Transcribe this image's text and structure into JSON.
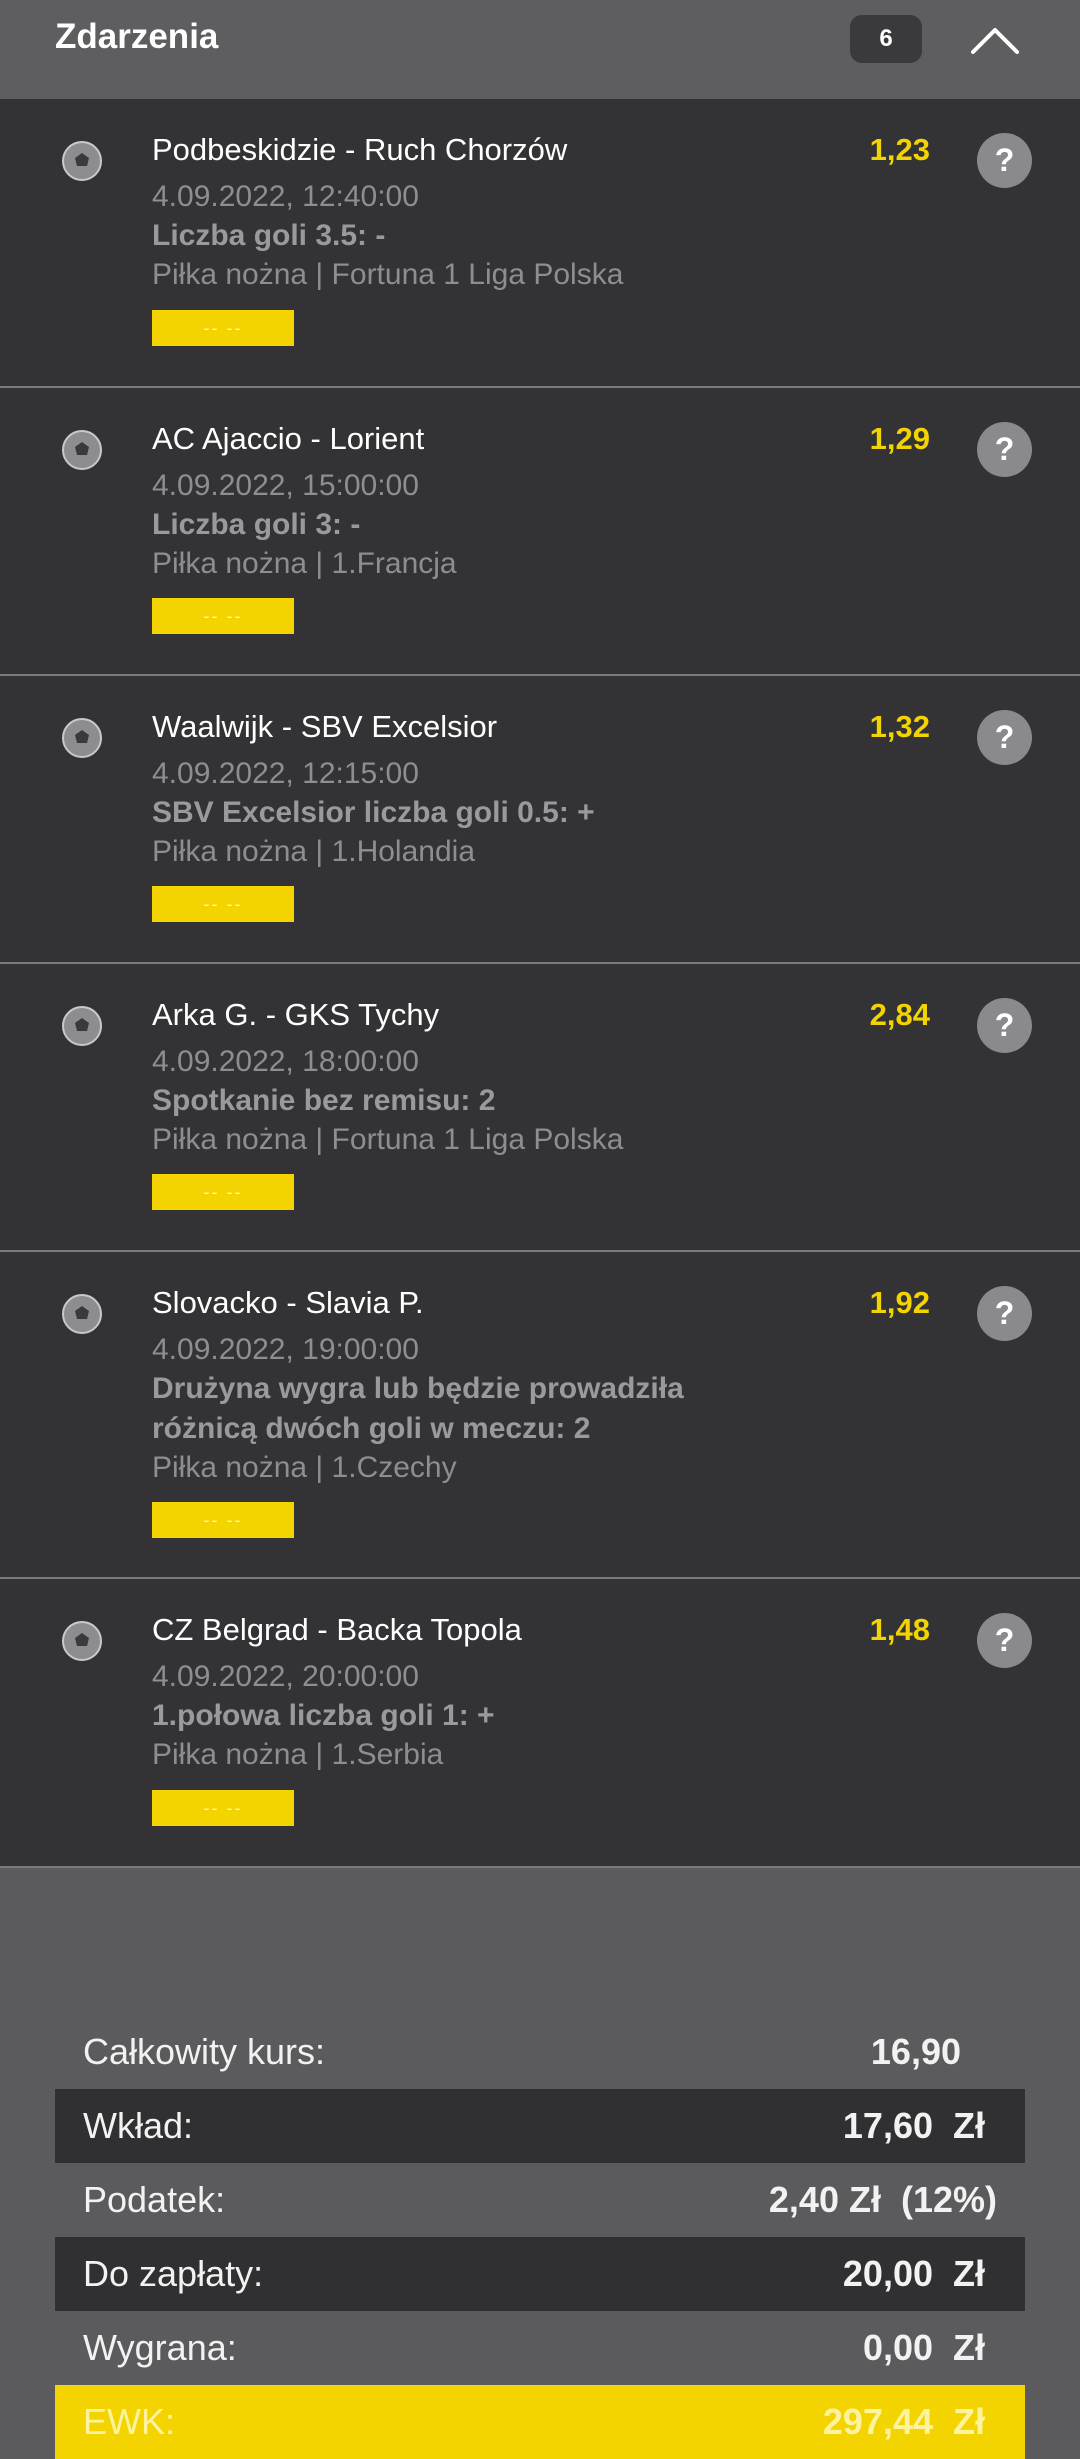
{
  "header": {
    "title": "Zdarzenia",
    "count": "6",
    "collapse_icon": "chevron-up-icon"
  },
  "events": [
    {
      "teams": "Podbeskidzie - Ruch Chorzów",
      "date": "4.09.2022, 12:40:00",
      "bet": "Liczba goli 3.5: -",
      "league": "Piłka nożna | Fortuna 1 Liga Polska",
      "odds": "1,23",
      "status": "-- --"
    },
    {
      "teams": "AC Ajaccio - Lorient",
      "date": "4.09.2022, 15:00:00",
      "bet": "Liczba goli 3: -",
      "league": "Piłka nożna | 1.Francja",
      "odds": "1,29",
      "status": "-- --"
    },
    {
      "teams": "Waalwijk - SBV Excelsior",
      "date": "4.09.2022, 12:15:00",
      "bet": "SBV Excelsior liczba goli 0.5: +",
      "league": "Piłka nożna | 1.Holandia",
      "odds": "1,32",
      "status": "-- --"
    },
    {
      "teams": "Arka G. - GKS Tychy",
      "date": "4.09.2022, 18:00:00",
      "bet": "Spotkanie bez remisu: 2",
      "league": "Piłka nożna | Fortuna 1 Liga Polska",
      "odds": "2,84",
      "status": "-- --"
    },
    {
      "teams": "Slovacko - Slavia P.",
      "date": "4.09.2022, 19:00:00",
      "bet": "Drużyna wygra lub będzie prowadziła różnicą dwóch goli w meczu: 2",
      "league": "Piłka nożna | 1.Czechy",
      "odds": "1,92",
      "status": "-- --"
    },
    {
      "teams": "CZ Belgrad - Backa Topola",
      "date": "4.09.2022, 20:00:00",
      "bet": "1.połowa liczba goli 1: +",
      "league": "Piłka nożna | 1.Serbia",
      "odds": "1,48",
      "status": "-- --"
    }
  ],
  "summary": {
    "total_odds_label": "Całkowity kurs:",
    "total_odds_value": "16,90",
    "stake_label": "Wkład:",
    "stake_value": "17,60  Zł",
    "tax_label": "Podatek:",
    "tax_value": "2,40 Zł  (12%)",
    "to_pay_label": "Do zapłaty:",
    "to_pay_value": "20,00  Zł",
    "win_label": "Wygrana:",
    "win_value": "0,00  Zł",
    "ewk_label": "EWK:",
    "ewk_value": "297,44  Zł"
  },
  "colors": {
    "accent_yellow": "#f3d400",
    "card_bg": "#333335",
    "page_bg": "#5b5b5d"
  }
}
